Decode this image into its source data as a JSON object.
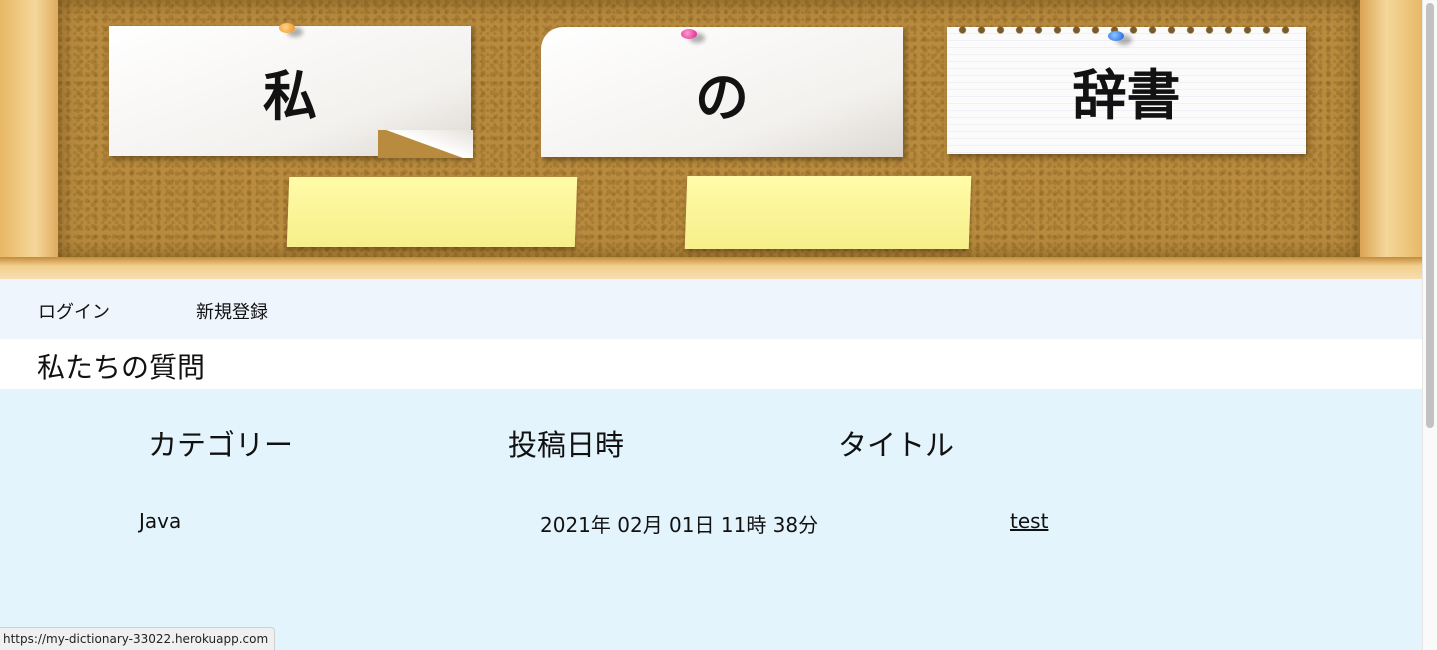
{
  "banner": {
    "note_left": "私",
    "note_middle": "の",
    "note_right": "辞書"
  },
  "nav": {
    "login": "ログイン",
    "signup": "新規登録"
  },
  "page": {
    "heading": "私たちの質問"
  },
  "table": {
    "headers": [
      "カテゴリー",
      "投稿日時",
      "タイトル"
    ],
    "rows": [
      {
        "category": "Java",
        "posted_at": "2021年 02月 01日 11時 38分",
        "title": "test"
      }
    ]
  },
  "statusbar": {
    "url": "https://my-dictionary-33022.herokuapp.com"
  }
}
